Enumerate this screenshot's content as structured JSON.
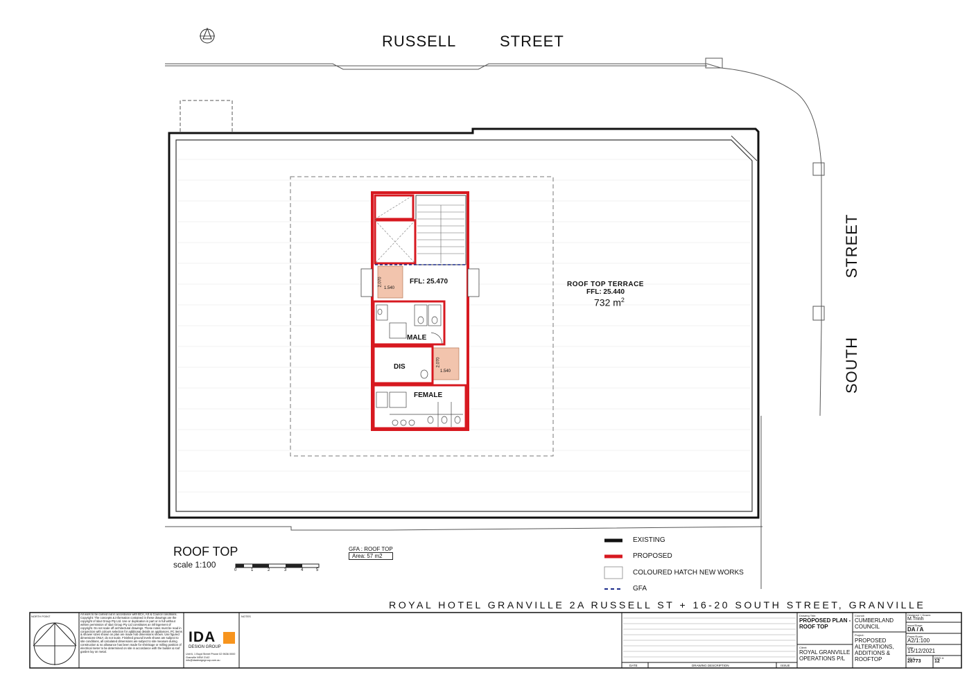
{
  "streets": {
    "russell_a": "RUSSELL",
    "russell_b": "STREET",
    "south_a": "STREET",
    "south_b": "SOUTH"
  },
  "rooms": {
    "ffl_core": "FFL: 25.470",
    "terrace_name": "ROOF TOP TERRACE",
    "terrace_ffl": "FFL: 25.440",
    "terrace_area": "732 m",
    "terrace_area_sup": "2",
    "male": "MALE",
    "dis": "DIS",
    "female": "FEMALE",
    "dim_a1": "1.540",
    "dim_a2": "2.070",
    "dim_b1": "1.540",
    "dim_b2": "2.070"
  },
  "plan": {
    "title": "ROOF TOP",
    "scale": "scale 1:100",
    "scale_ticks": [
      "0",
      "1",
      "2",
      "3",
      "4",
      "5"
    ],
    "gfa_title": "GFA : ROOF TOP",
    "gfa_area": "Area: 57 m2"
  },
  "legend": [
    {
      "label": "EXISTING",
      "color": "#111111",
      "style": "solid"
    },
    {
      "label": "PROPOSED",
      "color": "#d71920",
      "style": "solid"
    },
    {
      "label": "COLOURED HATCH NEW WORKS",
      "color": "#ffffff",
      "style": "box"
    },
    {
      "label": "GFA",
      "color": "#1a2a8a",
      "style": "dashed"
    }
  ],
  "colors": {
    "proposed": "#d71920",
    "hatch": "#f2c4ad",
    "gfa": "#1a2a8a",
    "ida_orange": "#f7941d"
  },
  "project_banner": "ROYAL HOTEL GRANVILLE 2A RUSSELL ST + 16-20 SOUTH STREET, GRANVILLE",
  "titleblock": {
    "logo_main": "IDA",
    "logo_sub": "DESIGN GROUP",
    "date_col": "DATE",
    "desc_col": "DRAWING DESCRIPTION",
    "issue_col": "ISSUE",
    "drawing_title_label": "Drawing Title:",
    "drawing_title": "PROPOSED PLAN - ROOF TOP",
    "client_label": "Client:",
    "client": "ROYAL GRANVILLE OPERATIONS P/L",
    "council_label": "Council:",
    "council": "CUMBERLAND COUNCIL",
    "project_label": "Project:",
    "project": "PROPOSED ALTERATIONS, ADDITIONS & ROOFTOP",
    "designed_label": "Designed + Drawn:",
    "designed": "M.Trinh",
    "status_label": "Issue/Stage:",
    "status": "DA / A",
    "paper_label": "Paper/Scale:",
    "paper": "A2/1:100",
    "date_label": "Date:",
    "date": "15/12/2021",
    "job_label": "Job #:",
    "job": "28773",
    "dwg_label": "DWG #:",
    "dwg": "12",
    "north_label": "NORTH POINT",
    "notes_label": "NOTES",
    "copyright_text": "All work to be carried out in accordance with BCA, AS & Council conditions. Copyright: The concepts & information contained in these drawings are the copyright of Ida4 Group Pty Ltd. Use or duplication in part or in full without written permission of Ida4 Group Pty Ltd constitutes an infringement of copyright. Do not scale off architectural drawings. These notes must be read in conjunction with colours selection for additional details on appliances, PC items & shower sizes shown on plan are made hob dimensions shown. Use figured dimensions ONLY, do not scale. Finished ground levels shown are subject to site conditions, all calculated dimensions are subject to site measure during construction & no allowance has been made for shrinkage or milling position of electrical meter to be determined on site in accordance with the builder & roof garden lay on metal.",
    "contact_text": "Unit 6, 1 Boyd Street  Phone 02 9636 0000  Granville NSW 2142  info@idadesigngroup.com.au"
  }
}
